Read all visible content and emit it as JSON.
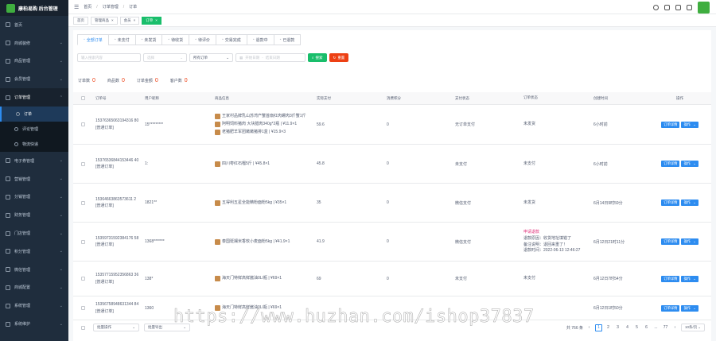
{
  "brand": {
    "title": "康柏易购 后台管理"
  },
  "sidebar": {
    "items": [
      {
        "label": "首页",
        "icon": "home-icon",
        "has_children": false
      },
      {
        "label": "商城装修",
        "icon": "decorate-icon",
        "has_children": true
      },
      {
        "label": "商品管理",
        "icon": "goods-icon",
        "has_children": true
      },
      {
        "label": "会员管理",
        "icon": "member-icon",
        "has_children": true
      },
      {
        "label": "订单管理",
        "icon": "order-icon",
        "has_children": true,
        "open": true
      }
    ],
    "sub_items": [
      {
        "label": "订单",
        "icon": "order-sub-icon",
        "active": true
      },
      {
        "label": "评论管理",
        "icon": "comment-icon",
        "active": false
      },
      {
        "label": "物流快递",
        "icon": "truck-icon",
        "active": false
      }
    ],
    "items_after": [
      {
        "label": "电子券管理",
        "icon": "coupon-icon"
      },
      {
        "label": "营销管理",
        "icon": "marketing-icon"
      },
      {
        "label": "分销管理",
        "icon": "distribution-icon"
      },
      {
        "label": "财务管理",
        "icon": "finance-icon"
      },
      {
        "label": "门店管理",
        "icon": "store-icon"
      },
      {
        "label": "积分管理",
        "icon": "points-icon"
      },
      {
        "label": "微信管理",
        "icon": "wechat-icon"
      },
      {
        "label": "商城配置",
        "icon": "config-icon"
      },
      {
        "label": "系统管理",
        "icon": "system-icon"
      },
      {
        "label": "系统维护",
        "icon": "maintain-icon"
      }
    ]
  },
  "topbar": {
    "breadcrumb": [
      "首页",
      "订单管理",
      "订单"
    ]
  },
  "tagbar": {
    "tags": [
      {
        "label": "首页",
        "active": false
      },
      {
        "label": "管理商品",
        "active": false
      },
      {
        "label": "会员",
        "active": false
      },
      {
        "label": "订单",
        "active": true
      }
    ]
  },
  "tabs": [
    {
      "label": "全部订单",
      "active": true
    },
    {
      "label": "未支付",
      "active": false
    },
    {
      "label": "未发货",
      "active": false
    },
    {
      "label": "待收货",
      "active": false
    },
    {
      "label": "待评价",
      "active": false
    },
    {
      "label": "交易完成",
      "active": false
    },
    {
      "label": "退款中",
      "active": false
    },
    {
      "label": "已退款",
      "active": false
    }
  ],
  "filters": {
    "keyword_placeholder": "输入搜索内容",
    "type_placeholder": "选择",
    "order_type": "所有订单",
    "start_placeholder": "开始日期",
    "sep": "结束日期",
    "search_label": "搜索",
    "reset_label": "重置"
  },
  "stats": [
    {
      "label": "订单数",
      "value": "0"
    },
    {
      "label": "商品数",
      "value": "0"
    },
    {
      "label": "订单金额",
      "value": "0"
    },
    {
      "label": "客户数",
      "value": "0"
    }
  ],
  "table": {
    "headers": [
      "订单号",
      "用户昵称",
      "商品信息",
      "实际支付",
      "消费积分",
      "支付状态",
      "订单状态",
      "创建时间",
      "操作"
    ],
    "rows": [
      {
        "no": "15376365063194316 80",
        "type": "[普通订单]",
        "user": "15*********",
        "goods": [
          "王家村品牌乳山苏湾产蟹首扇红肉螺肉3斤蟹1斤",
          "阿明饲料猪肉 大块腊肉340g*2瓶 | ¥11.9×1",
          "老猪肥羊军团嫩嫩猪排1盒 | ¥15.9×3"
        ],
        "pay": "59.6",
        "points": "0",
        "pay_status": "无订单支付",
        "order_status": [
          "未发货"
        ],
        "time": "6小时前"
      },
      {
        "no": "15376536844153446 40",
        "type": "[普通订单]",
        "user": "1:",
        "goods": [
          "四川枣红石榴5斤 | ¥45.8×1"
        ],
        "pay": "45.8",
        "points": "0",
        "pay_status": "未支付",
        "order_status": [
          "未支付"
        ],
        "time": "6小时前"
      },
      {
        "no": "15364663863573611 2",
        "type": "[普通订单]",
        "user": "1821**",
        "goods": [
          "五得利五星全能精粉面粉5kg | ¥35×1"
        ],
        "pay": "35",
        "points": "0",
        "pay_status": "微信支付",
        "order_status": [
          "未发货"
        ],
        "time": "6月14日9时59分"
      },
      {
        "no": "15359731592384176 58",
        "type": "[普通订单]",
        "user": "1368*******",
        "goods": [
          "泰国斑斓米香软小麦面粉5kg | ¥41.9×1"
        ],
        "pay": "41.9",
        "points": "0",
        "pay_status": "微信支付",
        "order_status": [
          "申请退款",
          "退款原因：收货地址填错了",
          "备注说明：退回来重了！",
          "退款时间：2022-06-13 12:46:27"
        ],
        "time": "6月12日21时11分"
      },
      {
        "no": "15357715952356863 36",
        "type": "[普通订单]",
        "user": "138*",
        "goods": [
          "海天门特鲜高鲜酱油0L/瓶 | ¥69×1"
        ],
        "pay": "69",
        "points": "0",
        "pay_status": "未支付",
        "order_status": [
          "未支付"
        ],
        "time": "6月12日7时54分"
      },
      {
        "no": "15356758948631344 84",
        "type": "[普通订单]",
        "user": "1360",
        "goods": [
          "海天门特鲜高鲜酱油0L/瓶 | ¥69×1"
        ],
        "pay": "",
        "points": "",
        "pay_status": "",
        "order_status": [
          ""
        ],
        "time": "6月12日1时50分"
      }
    ],
    "action_detail": "订单详情",
    "action_more": "操作"
  },
  "footer": {
    "bulk_label": "批量操作",
    "export_label": "批量导出",
    "total": "共 766 条",
    "pages": [
      "1",
      "2",
      "3",
      "4",
      "5",
      "6",
      "...",
      "77"
    ],
    "page_size": "10条/页"
  },
  "watermark": "https://www.huzhan.com/ishop37837",
  "colors": {
    "primary": "#2d8cf0",
    "success": "#19be6b",
    "danger": "#ed4014",
    "sidebar": "#1f2d3d"
  }
}
